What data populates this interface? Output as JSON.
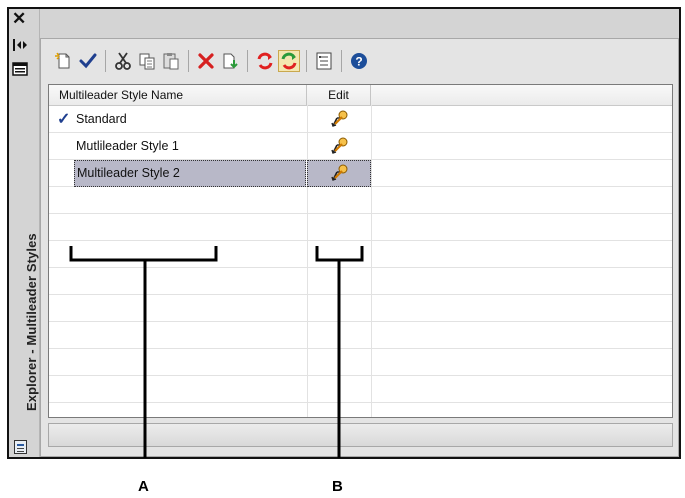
{
  "sidebar": {
    "close_glyph": "✕",
    "title": "Explorer - Multileader Styles",
    "icons": [
      "autohide-icon",
      "properties-icon",
      "panel-icon"
    ]
  },
  "toolbar": {
    "buttons": [
      "new-style-icon",
      "set-current-icon",
      "cut-icon",
      "copy-icon",
      "paste-icon",
      "delete-icon",
      "import-icon",
      "purge-icon",
      "purge-all-icon",
      "view-options-icon",
      "help-icon"
    ]
  },
  "table": {
    "headers": {
      "name": "Multileader Style Name",
      "edit": "Edit"
    },
    "rows": [
      {
        "name": "Standard",
        "current": true,
        "selected": false
      },
      {
        "name": "Mutlileader Style 1",
        "current": false,
        "selected": false
      },
      {
        "name": "Multileader Style 2",
        "current": false,
        "selected": true
      }
    ],
    "current_mark": "✓"
  },
  "callouts": {
    "a": "A",
    "b": "B"
  },
  "colors": {
    "check": "#1f3f8f",
    "delete": "#d62020",
    "help": "#1d4e9a",
    "selection": "#b8b8c8"
  }
}
